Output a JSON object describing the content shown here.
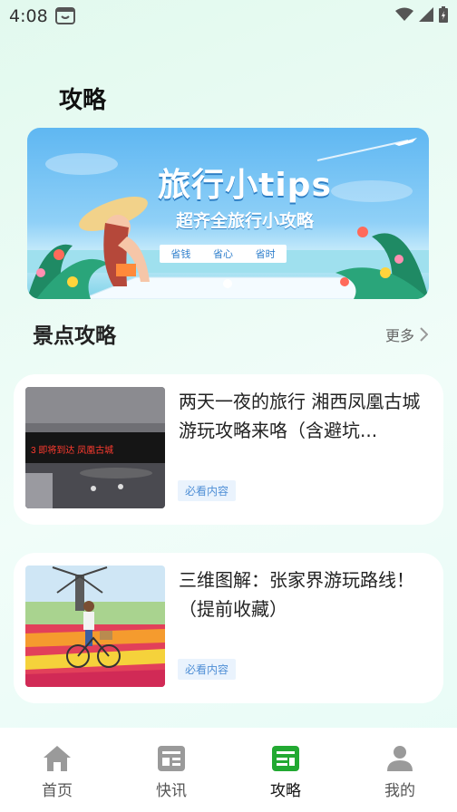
{
  "status_bar": {
    "time": "4:08",
    "icons": [
      "app-notification-icon",
      "wifi-icon",
      "signal-icon",
      "battery-charging-icon"
    ]
  },
  "page": {
    "title": "攻略"
  },
  "banner": {
    "title": "旅行小tips",
    "subtitle": "超齐全旅行小攻略",
    "tags": [
      "省钱",
      "省心",
      "省时"
    ]
  },
  "section": {
    "title": "景点攻略",
    "more_label": "更多"
  },
  "articles": [
    {
      "title": "两天一夜的旅行 湘西凤凰古城游玩攻略来咯（含避坑...",
      "tag": "必看内容",
      "thumb_sign_text": "3  即将到达  凤凰古城"
    },
    {
      "title": "三维图解：张家界游玩路线！（提前收藏）",
      "tag": "必看内容"
    }
  ],
  "tab_bar": {
    "tabs": [
      {
        "label": "首页",
        "icon": "home-icon"
      },
      {
        "label": "快讯",
        "icon": "news-icon"
      },
      {
        "label": "攻略",
        "icon": "guide-icon",
        "active": true
      },
      {
        "label": "我的",
        "icon": "profile-icon"
      }
    ]
  },
  "colors": {
    "accent": "#22a932",
    "tag_text": "#4f8fd6",
    "tag_bg": "#eaf3fd"
  }
}
